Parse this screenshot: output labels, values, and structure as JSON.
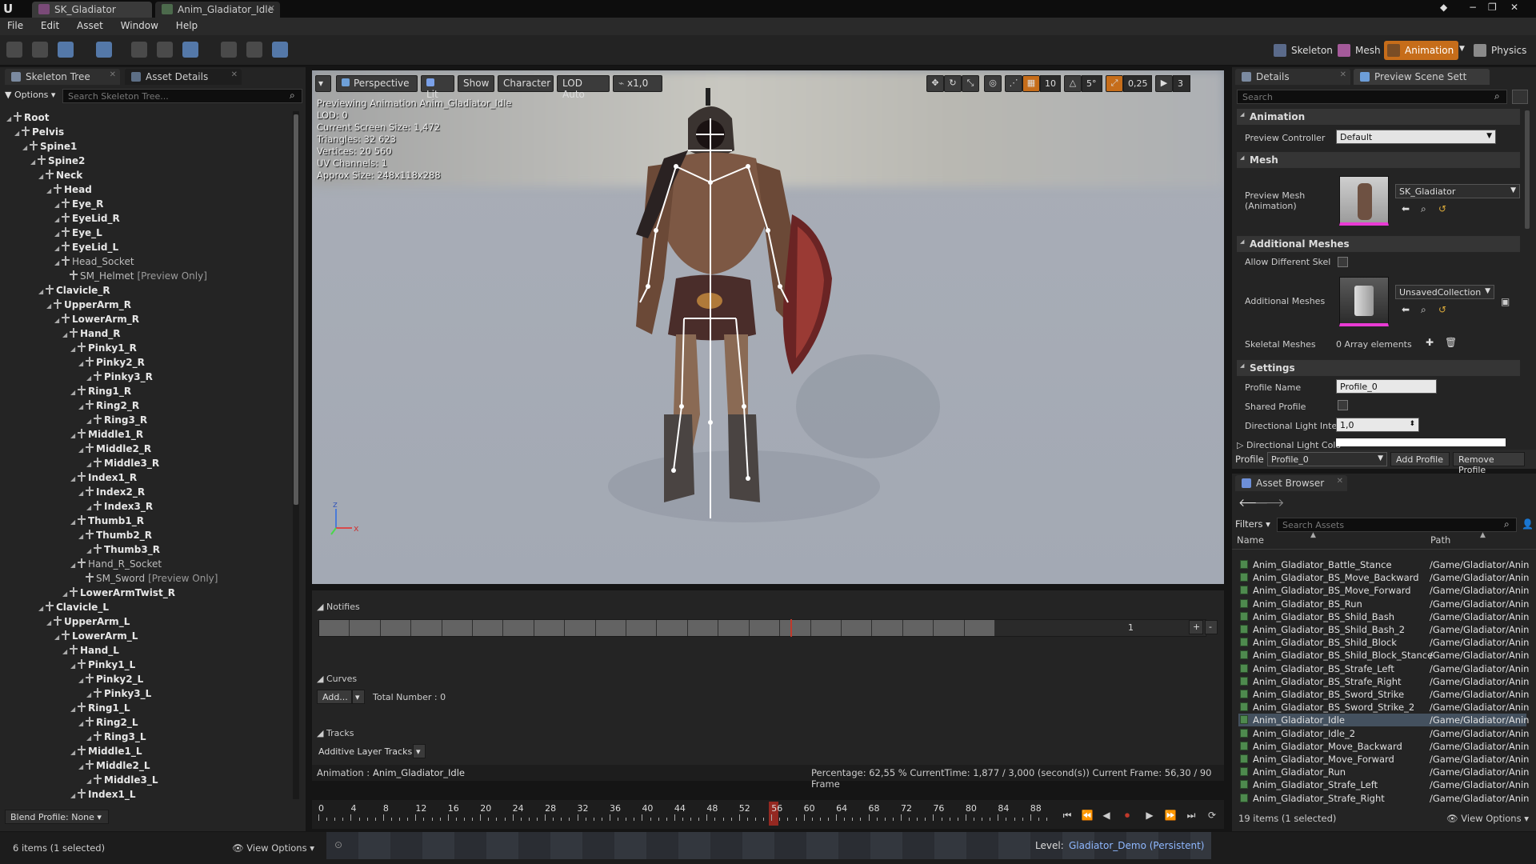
{
  "title_bar": {
    "tabs": [
      {
        "label": "SK_Gladiator"
      },
      {
        "label": "Anim_Gladiator_Idle"
      }
    ],
    "window_controls": [
      "−",
      "❐",
      "✕"
    ]
  },
  "menu": [
    "File",
    "Edit",
    "Asset",
    "Window",
    "Help"
  ],
  "modes": {
    "skeleton": "Skeleton",
    "mesh": "Mesh",
    "animation": "Animation",
    "physics": "Physics"
  },
  "skeleton_panel": {
    "tab_tree": "Skeleton Tree",
    "tab_details": "Asset Details",
    "options": "Options",
    "search_placeholder": "Search Skeleton Tree...",
    "blend_profile": "Blend Profile: None",
    "items_selected": "6 items (1 selected)",
    "view_options": "View Options",
    "bones": [
      {
        "name": "Root",
        "level": 0,
        "bold": true
      },
      {
        "name": "Pelvis",
        "level": 1,
        "bold": true
      },
      {
        "name": "Spine1",
        "level": 2,
        "bold": true
      },
      {
        "name": "Spine2",
        "level": 3,
        "bold": true
      },
      {
        "name": "Neck",
        "level": 4,
        "bold": true
      },
      {
        "name": "Head",
        "level": 5,
        "bold": true
      },
      {
        "name": "Eye_R",
        "level": 6,
        "bold": true
      },
      {
        "name": "EyeLid_R",
        "level": 6,
        "bold": true
      },
      {
        "name": "Eye_L",
        "level": 6,
        "bold": true
      },
      {
        "name": "EyeLid_L",
        "level": 6,
        "bold": true
      },
      {
        "name": "Head_Socket",
        "level": 6,
        "bold": false,
        "socket": true
      },
      {
        "name": "SM_Helmet",
        "level": 7,
        "bold": false,
        "preview": "[Preview Only]"
      },
      {
        "name": "Clavicle_R",
        "level": 4,
        "bold": true
      },
      {
        "name": "UpperArm_R",
        "level": 5,
        "bold": true
      },
      {
        "name": "LowerArm_R",
        "level": 6,
        "bold": true
      },
      {
        "name": "Hand_R",
        "level": 7,
        "bold": true
      },
      {
        "name": "Pinky1_R",
        "level": 8,
        "bold": true
      },
      {
        "name": "Pinky2_R",
        "level": 9,
        "bold": true
      },
      {
        "name": "Pinky3_R",
        "level": 10,
        "bold": true
      },
      {
        "name": "Ring1_R",
        "level": 8,
        "bold": true
      },
      {
        "name": "Ring2_R",
        "level": 9,
        "bold": true
      },
      {
        "name": "Ring3_R",
        "level": 10,
        "bold": true
      },
      {
        "name": "Middle1_R",
        "level": 8,
        "bold": true
      },
      {
        "name": "Middle2_R",
        "level": 9,
        "bold": true
      },
      {
        "name": "Middle3_R",
        "level": 10,
        "bold": true
      },
      {
        "name": "Index1_R",
        "level": 8,
        "bold": true
      },
      {
        "name": "Index2_R",
        "level": 9,
        "bold": true
      },
      {
        "name": "Index3_R",
        "level": 10,
        "bold": true
      },
      {
        "name": "Thumb1_R",
        "level": 8,
        "bold": true
      },
      {
        "name": "Thumb2_R",
        "level": 9,
        "bold": true
      },
      {
        "name": "Thumb3_R",
        "level": 10,
        "bold": true
      },
      {
        "name": "Hand_R_Socket",
        "level": 8,
        "bold": false,
        "socket": true
      },
      {
        "name": "SM_Sword",
        "level": 9,
        "bold": false,
        "preview": "[Preview Only]"
      },
      {
        "name": "LowerArmTwist_R",
        "level": 7,
        "bold": true
      },
      {
        "name": "Clavicle_L",
        "level": 4,
        "bold": true
      },
      {
        "name": "UpperArm_L",
        "level": 5,
        "bold": true
      },
      {
        "name": "LowerArm_L",
        "level": 6,
        "bold": true
      },
      {
        "name": "Hand_L",
        "level": 7,
        "bold": true
      },
      {
        "name": "Pinky1_L",
        "level": 8,
        "bold": true
      },
      {
        "name": "Pinky2_L",
        "level": 9,
        "bold": true
      },
      {
        "name": "Pinky3_L",
        "level": 10,
        "bold": true
      },
      {
        "name": "Ring1_L",
        "level": 8,
        "bold": true
      },
      {
        "name": "Ring2_L",
        "level": 9,
        "bold": true
      },
      {
        "name": "Ring3_L",
        "level": 10,
        "bold": true
      },
      {
        "name": "Middle1_L",
        "level": 8,
        "bold": true
      },
      {
        "name": "Middle2_L",
        "level": 9,
        "bold": true
      },
      {
        "name": "Middle3_L",
        "level": 10,
        "bold": true
      },
      {
        "name": "Index1_L",
        "level": 8,
        "bold": true
      }
    ]
  },
  "viewport": {
    "buttons": {
      "perspective": "Perspective",
      "lit": "Lit",
      "show": "Show",
      "character": "Character",
      "lod": "LOD Auto",
      "speed": "x1,0"
    },
    "snap_values": {
      "grid": "10",
      "angle": "5°",
      "scale": "0,25",
      "cam": "3"
    },
    "info_lines": [
      "Previewing Animation Anim_Gladiator_Idle",
      "LOD: 0",
      "Current Screen Size: 1,472",
      "Triangles: 32 623",
      "Vertices: 20 560",
      "UV Channels: 1",
      "Approx Size: 248x118x288"
    ],
    "axis_z": "z",
    "axis_x": "x"
  },
  "anim_panel": {
    "notifies": "Notifies",
    "notify_track_number": "1",
    "curves": "Curves",
    "add": "Add...",
    "total_number": "Total Number : 0",
    "tracks": "Tracks",
    "additive_layer": "Additive Layer Tracks",
    "animation_label": "Animation :",
    "animation_name": "Anim_Gladiator_Idle",
    "status": "Percentage:  62,55 % CurrentTime:  1,877 / 3,000 (second(s)) Current Frame:  56,30 / 90 Frame",
    "ticks": [
      "0",
      "4",
      "8",
      "12",
      "16",
      "20",
      "24",
      "28",
      "32",
      "36",
      "40",
      "44",
      "48",
      "52",
      "56",
      "60",
      "64",
      "68",
      "72",
      "76",
      "80",
      "84",
      "88"
    ],
    "current_tick": "56",
    "frames_total": 90,
    "current_frame": 56.3
  },
  "level": {
    "label": "Level:",
    "name": "Gladiator_Demo (Persistent)"
  },
  "details": {
    "tab_details": "Details",
    "tab_preview": "Preview Scene Sett",
    "search_placeholder": "Search",
    "animation_header": "Animation",
    "preview_controller_label": "Preview Controller",
    "preview_controller_value": "Default",
    "mesh_header": "Mesh",
    "preview_mesh_label": "Preview Mesh (Animation)",
    "preview_mesh_value": "SK_Gladiator",
    "additional_meshes_header": "Additional Meshes",
    "allow_diff_skel": "Allow Different Skel",
    "additional_meshes_label": "Additional Meshes",
    "additional_meshes_value": "UnsavedCollection",
    "skeletal_meshes_label": "Skeletal Meshes",
    "skeletal_meshes_value": "0 Array elements",
    "settings_header": "Settings",
    "profile_name_label": "Profile Name",
    "profile_name_value": "Profile_0",
    "shared_profile_label": "Shared Profile",
    "dir_light_int_label": "Directional Light Inten",
    "dir_light_int_value": "1,0",
    "dir_light_color_label": "Directional Light Colo",
    "profile_label": "Profile",
    "profile_value": "Profile_0",
    "add_profile": "Add Profile",
    "remove_profile": "Remove Profile"
  },
  "asset_browser": {
    "tab": "Asset Browser",
    "filters": "Filters",
    "search_placeholder": "Search Assets",
    "col_name": "Name",
    "col_path": "Path",
    "items": [
      {
        "name": "Anim_Gladiator_Battle_Stance",
        "path": "/Game/Gladiator/Anin"
      },
      {
        "name": "Anim_Gladiator_BS_Move_Backward",
        "path": "/Game/Gladiator/Anin"
      },
      {
        "name": "Anim_Gladiator_BS_Move_Forward",
        "path": "/Game/Gladiator/Anin"
      },
      {
        "name": "Anim_Gladiator_BS_Run",
        "path": "/Game/Gladiator/Anin"
      },
      {
        "name": "Anim_Gladiator_BS_Shild_Bash",
        "path": "/Game/Gladiator/Anin"
      },
      {
        "name": "Anim_Gladiator_BS_Shild_Bash_2",
        "path": "/Game/Gladiator/Anin"
      },
      {
        "name": "Anim_Gladiator_BS_Shild_Block",
        "path": "/Game/Gladiator/Anin"
      },
      {
        "name": "Anim_Gladiator_BS_Shild_Block_Stance",
        "path": "/Game/Gladiator/Anin"
      },
      {
        "name": "Anim_Gladiator_BS_Strafe_Left",
        "path": "/Game/Gladiator/Anin"
      },
      {
        "name": "Anim_Gladiator_BS_Strafe_Right",
        "path": "/Game/Gladiator/Anin"
      },
      {
        "name": "Anim_Gladiator_BS_Sword_Strike",
        "path": "/Game/Gladiator/Anin"
      },
      {
        "name": "Anim_Gladiator_BS_Sword_Strike_2",
        "path": "/Game/Gladiator/Anin"
      },
      {
        "name": "Anim_Gladiator_Idle",
        "path": "/Game/Gladiator/Anin",
        "selected": true
      },
      {
        "name": "Anim_Gladiator_Idle_2",
        "path": "/Game/Gladiator/Anin"
      },
      {
        "name": "Anim_Gladiator_Move_Backward",
        "path": "/Game/Gladiator/Anin"
      },
      {
        "name": "Anim_Gladiator_Move_Forward",
        "path": "/Game/Gladiator/Anin"
      },
      {
        "name": "Anim_Gladiator_Run",
        "path": "/Game/Gladiator/Anin"
      },
      {
        "name": "Anim_Gladiator_Strafe_Left",
        "path": "/Game/Gladiator/Anin"
      },
      {
        "name": "Anim_Gladiator_Strafe_Right",
        "path": "/Game/Gladiator/Anin"
      }
    ],
    "count": "19 items (1 selected)",
    "view_options": "View Options"
  },
  "colors": {
    "accent": "#c66d1a",
    "selection": "#44515f",
    "playhead": "#c0392b"
  }
}
